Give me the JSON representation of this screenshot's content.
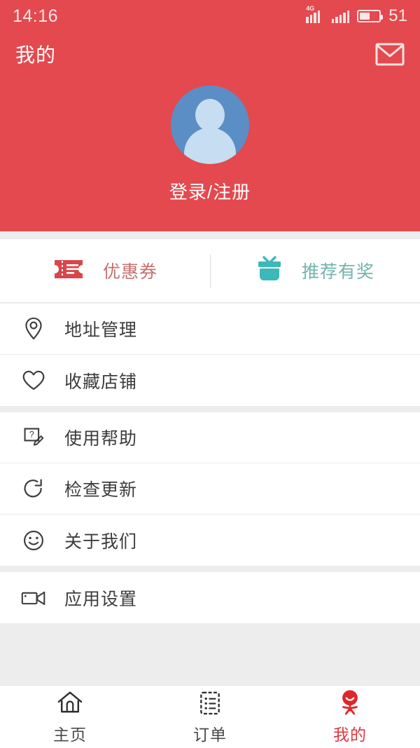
{
  "theme": {
    "primary_red": "#e3494e",
    "accent_red": "#e0373c",
    "teal": "#3cb8b8",
    "page_bg": "#ededed"
  },
  "status_bar": {
    "time": "14:16",
    "network_type": "4G",
    "signal_icon_1": "signal-bars-4g-icon",
    "signal_icon_2": "signal-bars-icon",
    "battery_icon": "battery-icon",
    "battery_percent": "51"
  },
  "header": {
    "title": "我的",
    "mail_icon": "mail-envelope-icon",
    "avatar_icon": "user-avatar-placeholder",
    "login_label": "登录/注册"
  },
  "quick_actions": [
    {
      "label": "优惠券",
      "icon": "coupon-ticket-icon",
      "color": "#c4716f"
    },
    {
      "label": "推荐有奖",
      "icon": "gift-box-icon",
      "color": "#72b3ae"
    }
  ],
  "menu_groups": [
    {
      "items": [
        {
          "label": "地址管理",
          "icon": "location-pin-icon"
        },
        {
          "label": "收藏店铺",
          "icon": "heart-icon"
        }
      ]
    },
    {
      "items": [
        {
          "label": "使用帮助",
          "icon": "help-note-pencil-icon"
        },
        {
          "label": "检查更新",
          "icon": "refresh-circular-arrow-icon"
        },
        {
          "label": "关于我们",
          "icon": "smiley-face-icon"
        }
      ]
    },
    {
      "items": [
        {
          "label": "应用设置",
          "icon": "video-camera-icon"
        }
      ]
    }
  ],
  "bottom_nav": [
    {
      "label": "主页",
      "icon": "home-icon",
      "active": false
    },
    {
      "label": "订单",
      "icon": "order-list-clipboard-icon",
      "active": false
    },
    {
      "label": "我的",
      "icon": "profile-person-icon",
      "active": true
    }
  ]
}
